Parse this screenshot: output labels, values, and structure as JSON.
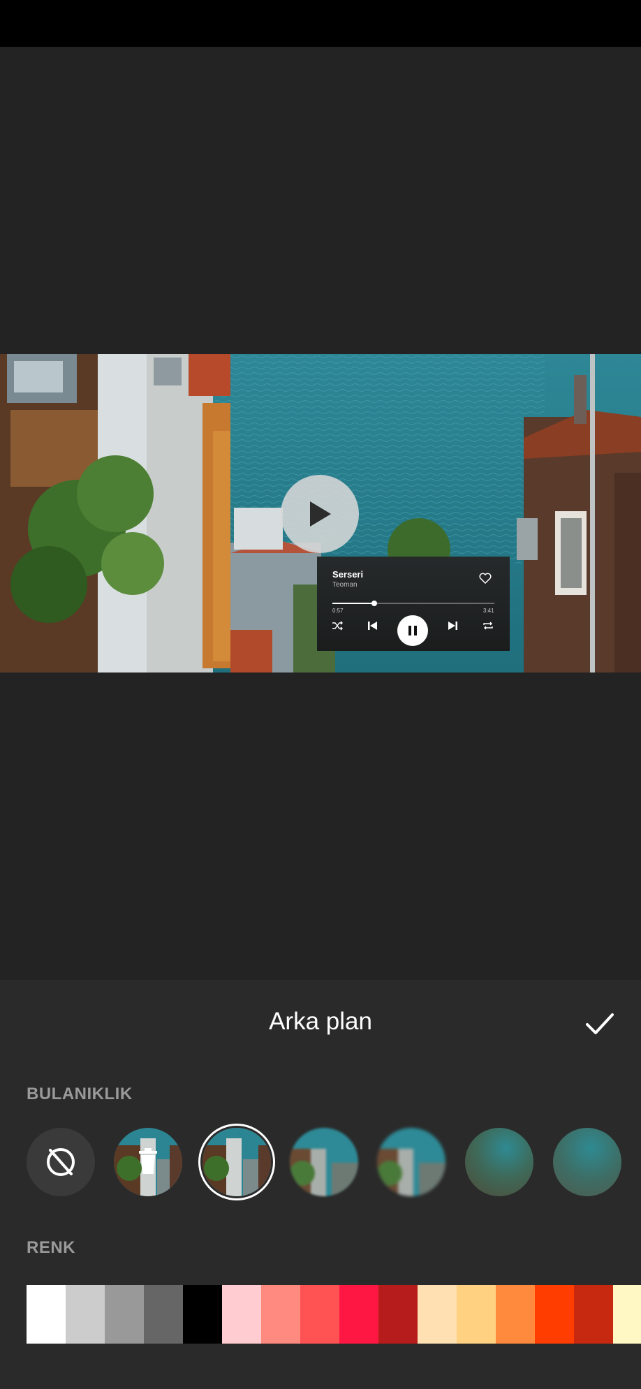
{
  "player_sticker": {
    "song": "Serseri",
    "artist": "Teoman",
    "elapsed": "0:57",
    "duration": "3:41",
    "progress": 0.258
  },
  "sheet": {
    "title": "Arka plan",
    "blur_section_label": "BULANIKLIK",
    "color_section_label": "RENK",
    "blur_options": [
      "none",
      "image-delete",
      "image-sharp",
      "blur-1",
      "blur-2",
      "blur-3",
      "blur-4"
    ],
    "selected_blur_index": 2
  },
  "swatches": [
    "#ffffff",
    "#cccccc",
    "#999999",
    "#666666",
    "#000000",
    "#ffccd2",
    "#ff8a80",
    "#ff5252",
    "#ff1744",
    "#b71c1c",
    "#ffe0b2",
    "#ffd180",
    "#ff8a3d",
    "#ff3d00",
    "#c62810",
    "#fff8c4"
  ],
  "icons": [
    "play-icon",
    "heart-icon",
    "shuffle-icon",
    "previous-icon",
    "pause-icon",
    "next-icon",
    "repeat-icon",
    "checkmark-icon",
    "no-blur-icon",
    "trash-icon"
  ]
}
